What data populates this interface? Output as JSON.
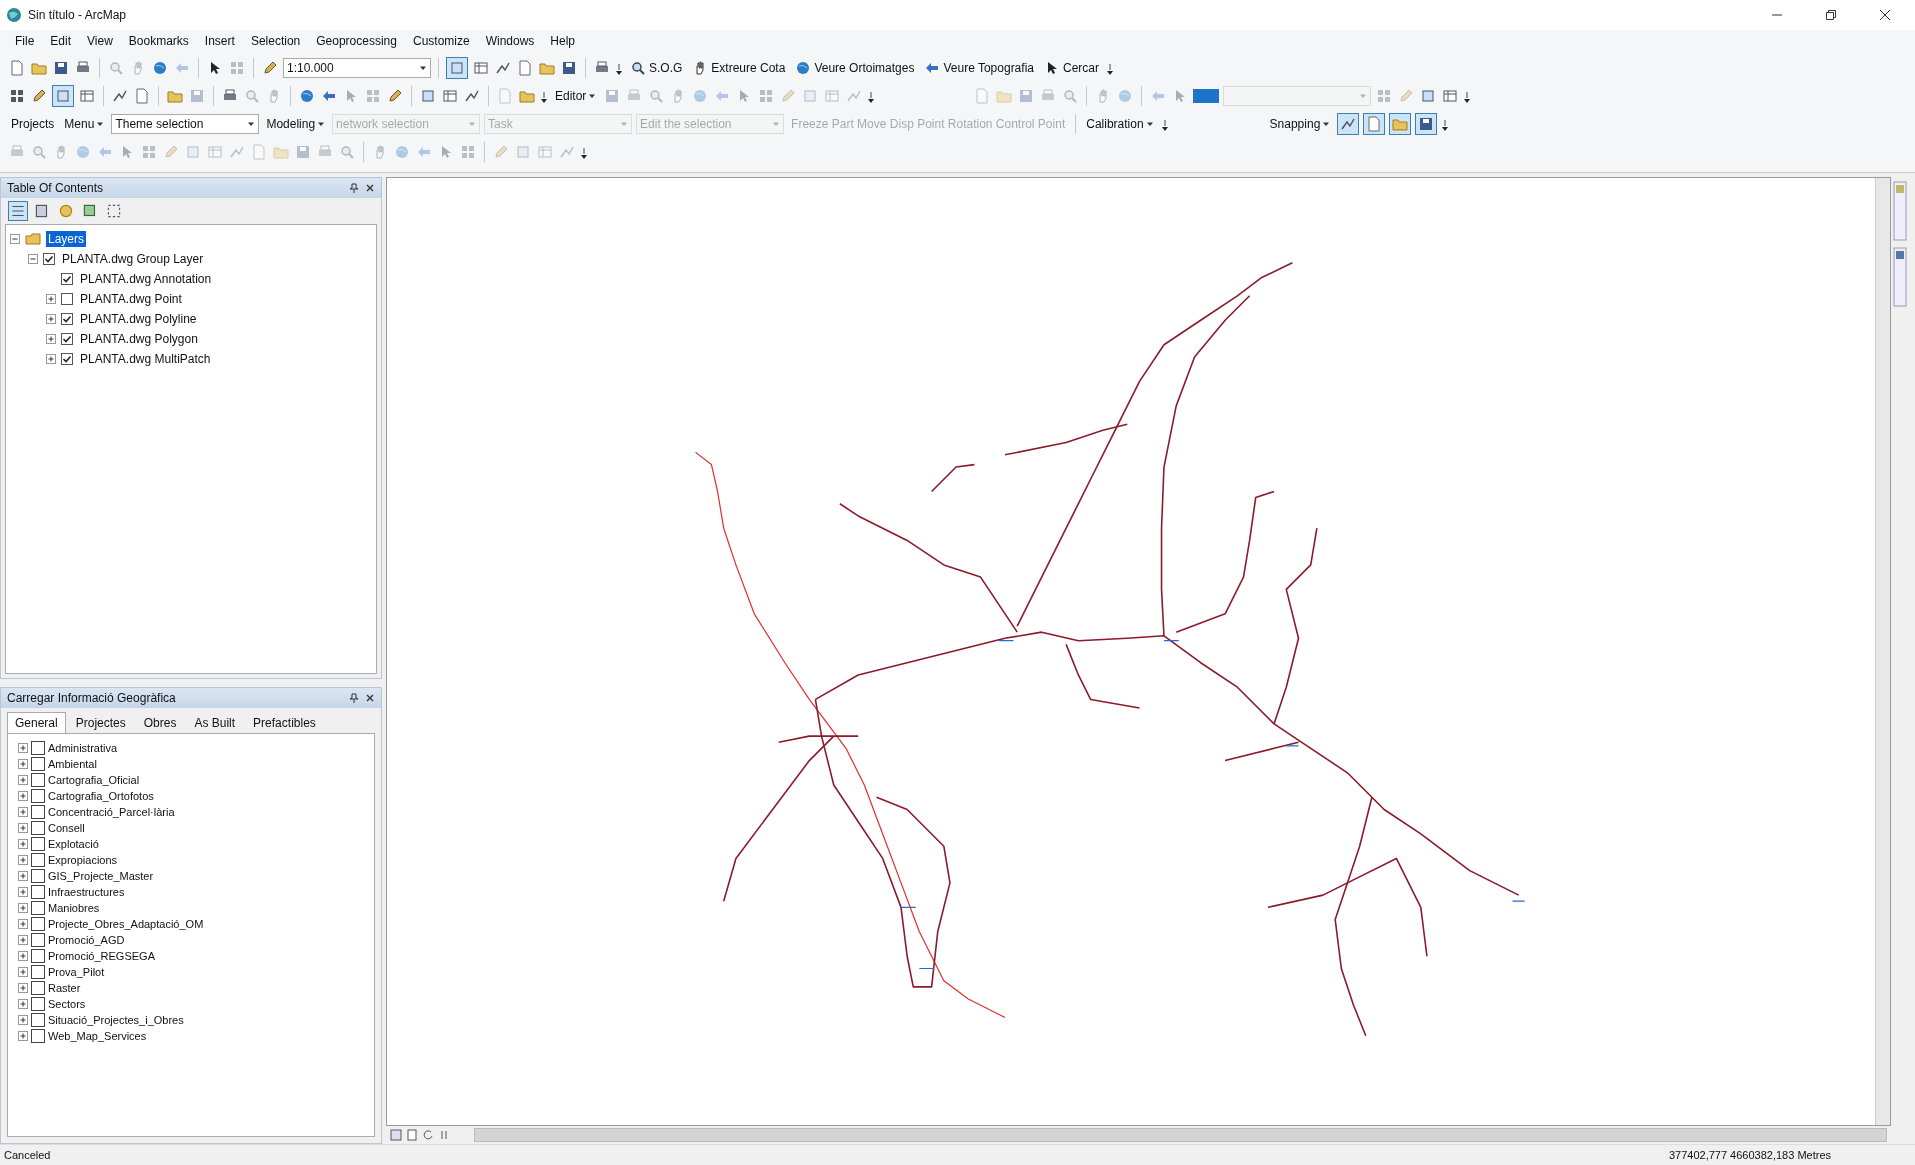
{
  "window": {
    "title": "Sin título - ArcMap"
  },
  "menu": [
    "File",
    "Edit",
    "View",
    "Bookmarks",
    "Insert",
    "Selection",
    "Geoprocessing",
    "Customize",
    "Windows",
    "Help"
  ],
  "toolbars": [
    {
      "items": [
        {
          "kind": "tool",
          "disabled": false
        },
        {
          "kind": "tool",
          "disabled": false
        },
        {
          "kind": "tool",
          "disabled": false
        },
        {
          "kind": "tool",
          "disabled": false
        },
        {
          "kind": "sep"
        },
        {
          "kind": "tool",
          "disabled": true
        },
        {
          "kind": "tool",
          "disabled": true
        },
        {
          "kind": "tool",
          "disabled": false
        },
        {
          "kind": "tool",
          "disabled": true
        },
        {
          "kind": "sep"
        },
        {
          "kind": "tool",
          "disabled": false
        },
        {
          "kind": "tool",
          "disabled": true
        },
        {
          "kind": "sep"
        },
        {
          "kind": "tool",
          "disabled": false
        },
        {
          "kind": "dropdown",
          "value": "1:10.000",
          "disabled": false
        },
        {
          "kind": "sep"
        },
        {
          "kind": "tool",
          "disabled": false,
          "on": true
        },
        {
          "kind": "tool",
          "disabled": false
        },
        {
          "kind": "tool",
          "disabled": false
        },
        {
          "kind": "tool",
          "disabled": false
        },
        {
          "kind": "tool",
          "disabled": false
        },
        {
          "kind": "tool",
          "disabled": false
        },
        {
          "kind": "sep"
        },
        {
          "kind": "tool",
          "disabled": false
        },
        {
          "kind": "grip"
        },
        {
          "kind": "command",
          "label": "S.O.G",
          "disabled": false
        },
        {
          "kind": "command",
          "label": "Extreure Cota",
          "disabled": false
        },
        {
          "kind": "command",
          "label": "Veure Ortoimatges",
          "disabled": false
        },
        {
          "kind": "command",
          "label": "Veure Topografia",
          "disabled": false
        },
        {
          "kind": "command",
          "label": "Cercar",
          "disabled": false
        },
        {
          "kind": "grip"
        }
      ]
    },
    {
      "items": [
        {
          "kind": "tool",
          "disabled": false
        },
        {
          "kind": "tool",
          "disabled": false
        },
        {
          "kind": "tool",
          "disabled": false,
          "on": true
        },
        {
          "kind": "tool",
          "disabled": false
        },
        {
          "kind": "sep"
        },
        {
          "kind": "tool",
          "disabled": false
        },
        {
          "kind": "tool",
          "disabled": false
        },
        {
          "kind": "sep"
        },
        {
          "kind": "tool",
          "disabled": false
        },
        {
          "kind": "tool",
          "disabled": true
        },
        {
          "kind": "sep"
        },
        {
          "kind": "tool",
          "disabled": false
        },
        {
          "kind": "tool",
          "disabled": true
        },
        {
          "kind": "tool",
          "disabled": true
        },
        {
          "kind": "sep"
        },
        {
          "kind": "tool",
          "disabled": false
        },
        {
          "kind": "tool",
          "disabled": false
        },
        {
          "kind": "tool",
          "disabled": true
        },
        {
          "kind": "tool",
          "disabled": true
        },
        {
          "kind": "tool",
          "disabled": false
        },
        {
          "kind": "sep"
        },
        {
          "kind": "tool",
          "disabled": false
        },
        {
          "kind": "tool",
          "disabled": false
        },
        {
          "kind": "tool",
          "disabled": false
        },
        {
          "kind": "sep"
        },
        {
          "kind": "tool",
          "disabled": true
        },
        {
          "kind": "tool",
          "disabled": false
        },
        {
          "kind": "grip"
        },
        {
          "kind": "menu",
          "label": "Editor",
          "disabled": false
        },
        {
          "kind": "tool",
          "disabled": true
        },
        {
          "kind": "tool",
          "disabled": true
        },
        {
          "kind": "tool",
          "disabled": true
        },
        {
          "kind": "tool",
          "disabled": true
        },
        {
          "kind": "tool",
          "disabled": true
        },
        {
          "kind": "tool",
          "disabled": true
        },
        {
          "kind": "tool",
          "disabled": true
        },
        {
          "kind": "tool",
          "disabled": true
        },
        {
          "kind": "tool",
          "disabled": true
        },
        {
          "kind": "tool",
          "disabled": true
        },
        {
          "kind": "tool",
          "disabled": true
        },
        {
          "kind": "tool",
          "disabled": true
        },
        {
          "kind": "grip"
        },
        {
          "kind": "gap"
        },
        {
          "kind": "tool",
          "disabled": true
        },
        {
          "kind": "tool",
          "disabled": true
        },
        {
          "kind": "tool",
          "disabled": true
        },
        {
          "kind": "tool",
          "disabled": true
        },
        {
          "kind": "tool",
          "disabled": true
        },
        {
          "kind": "sep"
        },
        {
          "kind": "tool",
          "disabled": true
        },
        {
          "kind": "tool",
          "disabled": true
        },
        {
          "kind": "sep"
        },
        {
          "kind": "tool",
          "disabled": true
        },
        {
          "kind": "tool",
          "disabled": true
        },
        {
          "kind": "swatch"
        },
        {
          "kind": "dropdown",
          "value": "",
          "disabled": true
        },
        {
          "kind": "tool",
          "disabled": true
        },
        {
          "kind": "tool",
          "disabled": true
        },
        {
          "kind": "tool",
          "disabled": false
        },
        {
          "kind": "tool",
          "disabled": false
        },
        {
          "kind": "grip"
        }
      ]
    },
    {
      "items": [
        {
          "kind": "label",
          "text": "Projects"
        },
        {
          "kind": "menu",
          "label": "Menu",
          "disabled": false
        },
        {
          "kind": "dropdown",
          "value": "Theme selection",
          "disabled": false
        },
        {
          "kind": "menu",
          "label": "Modeling",
          "disabled": false
        },
        {
          "kind": "dropdown",
          "value": "network selection",
          "disabled": true
        },
        {
          "kind": "dropdown",
          "value": "Task",
          "disabled": true
        },
        {
          "kind": "dropdown",
          "value": "Edit the selection",
          "disabled": true
        },
        {
          "kind": "label",
          "text": "Freeze Part  Move Disp Point  Rotation  Control Point",
          "disabled": true
        },
        {
          "kind": "sep"
        },
        {
          "kind": "menu",
          "label": "Calibration",
          "disabled": false
        },
        {
          "kind": "grip"
        },
        {
          "kind": "gap"
        },
        {
          "kind": "menu",
          "label": "Snapping",
          "disabled": false
        },
        {
          "kind": "tool",
          "disabled": false,
          "on": true
        },
        {
          "kind": "tool",
          "disabled": false,
          "on": true
        },
        {
          "kind": "tool",
          "disabled": false,
          "on": true
        },
        {
          "kind": "tool",
          "disabled": false,
          "on": true
        },
        {
          "kind": "grip"
        }
      ]
    },
    {
      "items": [
        {
          "kind": "tool",
          "disabled": true
        },
        {
          "kind": "tool",
          "disabled": true
        },
        {
          "kind": "tool",
          "disabled": true
        },
        {
          "kind": "tool",
          "disabled": true
        },
        {
          "kind": "tool",
          "disabled": true
        },
        {
          "kind": "tool",
          "disabled": true
        },
        {
          "kind": "tool",
          "disabled": true
        },
        {
          "kind": "tool",
          "disabled": true
        },
        {
          "kind": "tool",
          "disabled": true
        },
        {
          "kind": "tool",
          "disabled": true
        },
        {
          "kind": "tool",
          "disabled": true
        },
        {
          "kind": "tool",
          "disabled": true
        },
        {
          "kind": "tool",
          "disabled": true
        },
        {
          "kind": "tool",
          "disabled": true
        },
        {
          "kind": "tool",
          "disabled": true
        },
        {
          "kind": "tool",
          "disabled": true
        },
        {
          "kind": "sep"
        },
        {
          "kind": "tool",
          "disabled": true
        },
        {
          "kind": "tool",
          "disabled": true
        },
        {
          "kind": "tool",
          "disabled": true
        },
        {
          "kind": "tool",
          "disabled": true
        },
        {
          "kind": "tool",
          "disabled": true
        },
        {
          "kind": "sep"
        },
        {
          "kind": "tool",
          "disabled": true
        },
        {
          "kind": "tool",
          "disabled": true
        },
        {
          "kind": "tool",
          "disabled": true
        },
        {
          "kind": "tool",
          "disabled": true
        },
        {
          "kind": "grip"
        }
      ]
    }
  ],
  "toc": {
    "title": "Table Of Contents",
    "tree": [
      {
        "label": "Layers",
        "selected": true,
        "expanded": true,
        "children": [
          {
            "label": "PLANTA.dwg Group Layer",
            "checked": true,
            "expanded": true,
            "children": [
              {
                "label": "PLANTA.dwg Annotation",
                "checked": true
              },
              {
                "label": "PLANTA.dwg Point",
                "checked": false,
                "expanded": false
              },
              {
                "label": "PLANTA.dwg Polyline",
                "checked": true,
                "expanded": false
              },
              {
                "label": "PLANTA.dwg Polygon",
                "checked": true,
                "expanded": false
              },
              {
                "label": "PLANTA.dwg MultiPatch",
                "checked": true,
                "expanded": false
              }
            ]
          }
        ]
      }
    ]
  },
  "load_panel": {
    "title": "Carregar Informació Geogràfica",
    "tabs": [
      {
        "label": "General",
        "selected": true
      },
      {
        "label": "Projectes",
        "selected": false
      },
      {
        "label": "Obres",
        "selected": false
      },
      {
        "label": "As Built",
        "selected": false
      },
      {
        "label": "Prefactibles",
        "selected": false
      }
    ],
    "layers": [
      {
        "label": "Administrativa",
        "checked": false,
        "expanded": false
      },
      {
        "label": "Ambiental",
        "checked": false,
        "expanded": false
      },
      {
        "label": "Cartografia_Oficial",
        "checked": false,
        "expanded": false
      },
      {
        "label": "Cartografia_Ortofotos",
        "checked": false,
        "expanded": false
      },
      {
        "label": "Concentració_Parcel·lària",
        "checked": false,
        "expanded": false
      },
      {
        "label": "Consell",
        "checked": false,
        "expanded": false
      },
      {
        "label": "Explotació",
        "checked": false,
        "expanded": false
      },
      {
        "label": "Expropiacions",
        "checked": false,
        "expanded": false
      },
      {
        "label": "GIS_Projecte_Master",
        "checked": false,
        "expanded": false
      },
      {
        "label": "Infraestructures",
        "checked": false,
        "expanded": false
      },
      {
        "label": "Maniobres",
        "checked": false,
        "expanded": false
      },
      {
        "label": "Projecte_Obres_Adaptació_OM",
        "checked": false,
        "expanded": false
      },
      {
        "label": "Promoció_AGD",
        "checked": false,
        "expanded": false
      },
      {
        "label": "Promoció_REGSEGA",
        "checked": false,
        "expanded": false
      },
      {
        "label": "Prova_Pilot",
        "checked": false,
        "expanded": false
      },
      {
        "label": "Raster",
        "checked": false,
        "expanded": false
      },
      {
        "label": "Sectors",
        "checked": false,
        "expanded": false
      },
      {
        "label": "Situació_Projectes_i_Obres",
        "checked": false,
        "expanded": false
      },
      {
        "label": "Web_Map_Services",
        "checked": false,
        "expanded": false
      }
    ]
  },
  "status_bar": {
    "message": "Canceled",
    "coordinates": "377402,777  4660382,183 Metres"
  }
}
